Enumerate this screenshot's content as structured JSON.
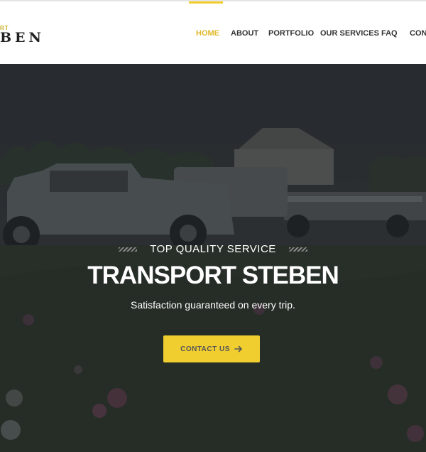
{
  "logo": {
    "top": "RT",
    "main": "BEN"
  },
  "nav": {
    "items": [
      {
        "label": "HOME",
        "active": true
      },
      {
        "label": "ABOUT"
      },
      {
        "label": "PORTFOLIO"
      },
      {
        "label": "OUR SERVICES"
      },
      {
        "label": "FAQ"
      },
      {
        "label": "CON"
      }
    ],
    "accent": "#f2cc2b"
  },
  "hero": {
    "subtitle": "TOP QUALITY SERVICE",
    "title": "TRANSPORT STEBEN",
    "tagline": "Satisfaction guaranteed on every trip.",
    "cta_label": "CONTACT US",
    "cta_color": "#f0ce30",
    "cta_icon": "arrow-right-icon"
  }
}
